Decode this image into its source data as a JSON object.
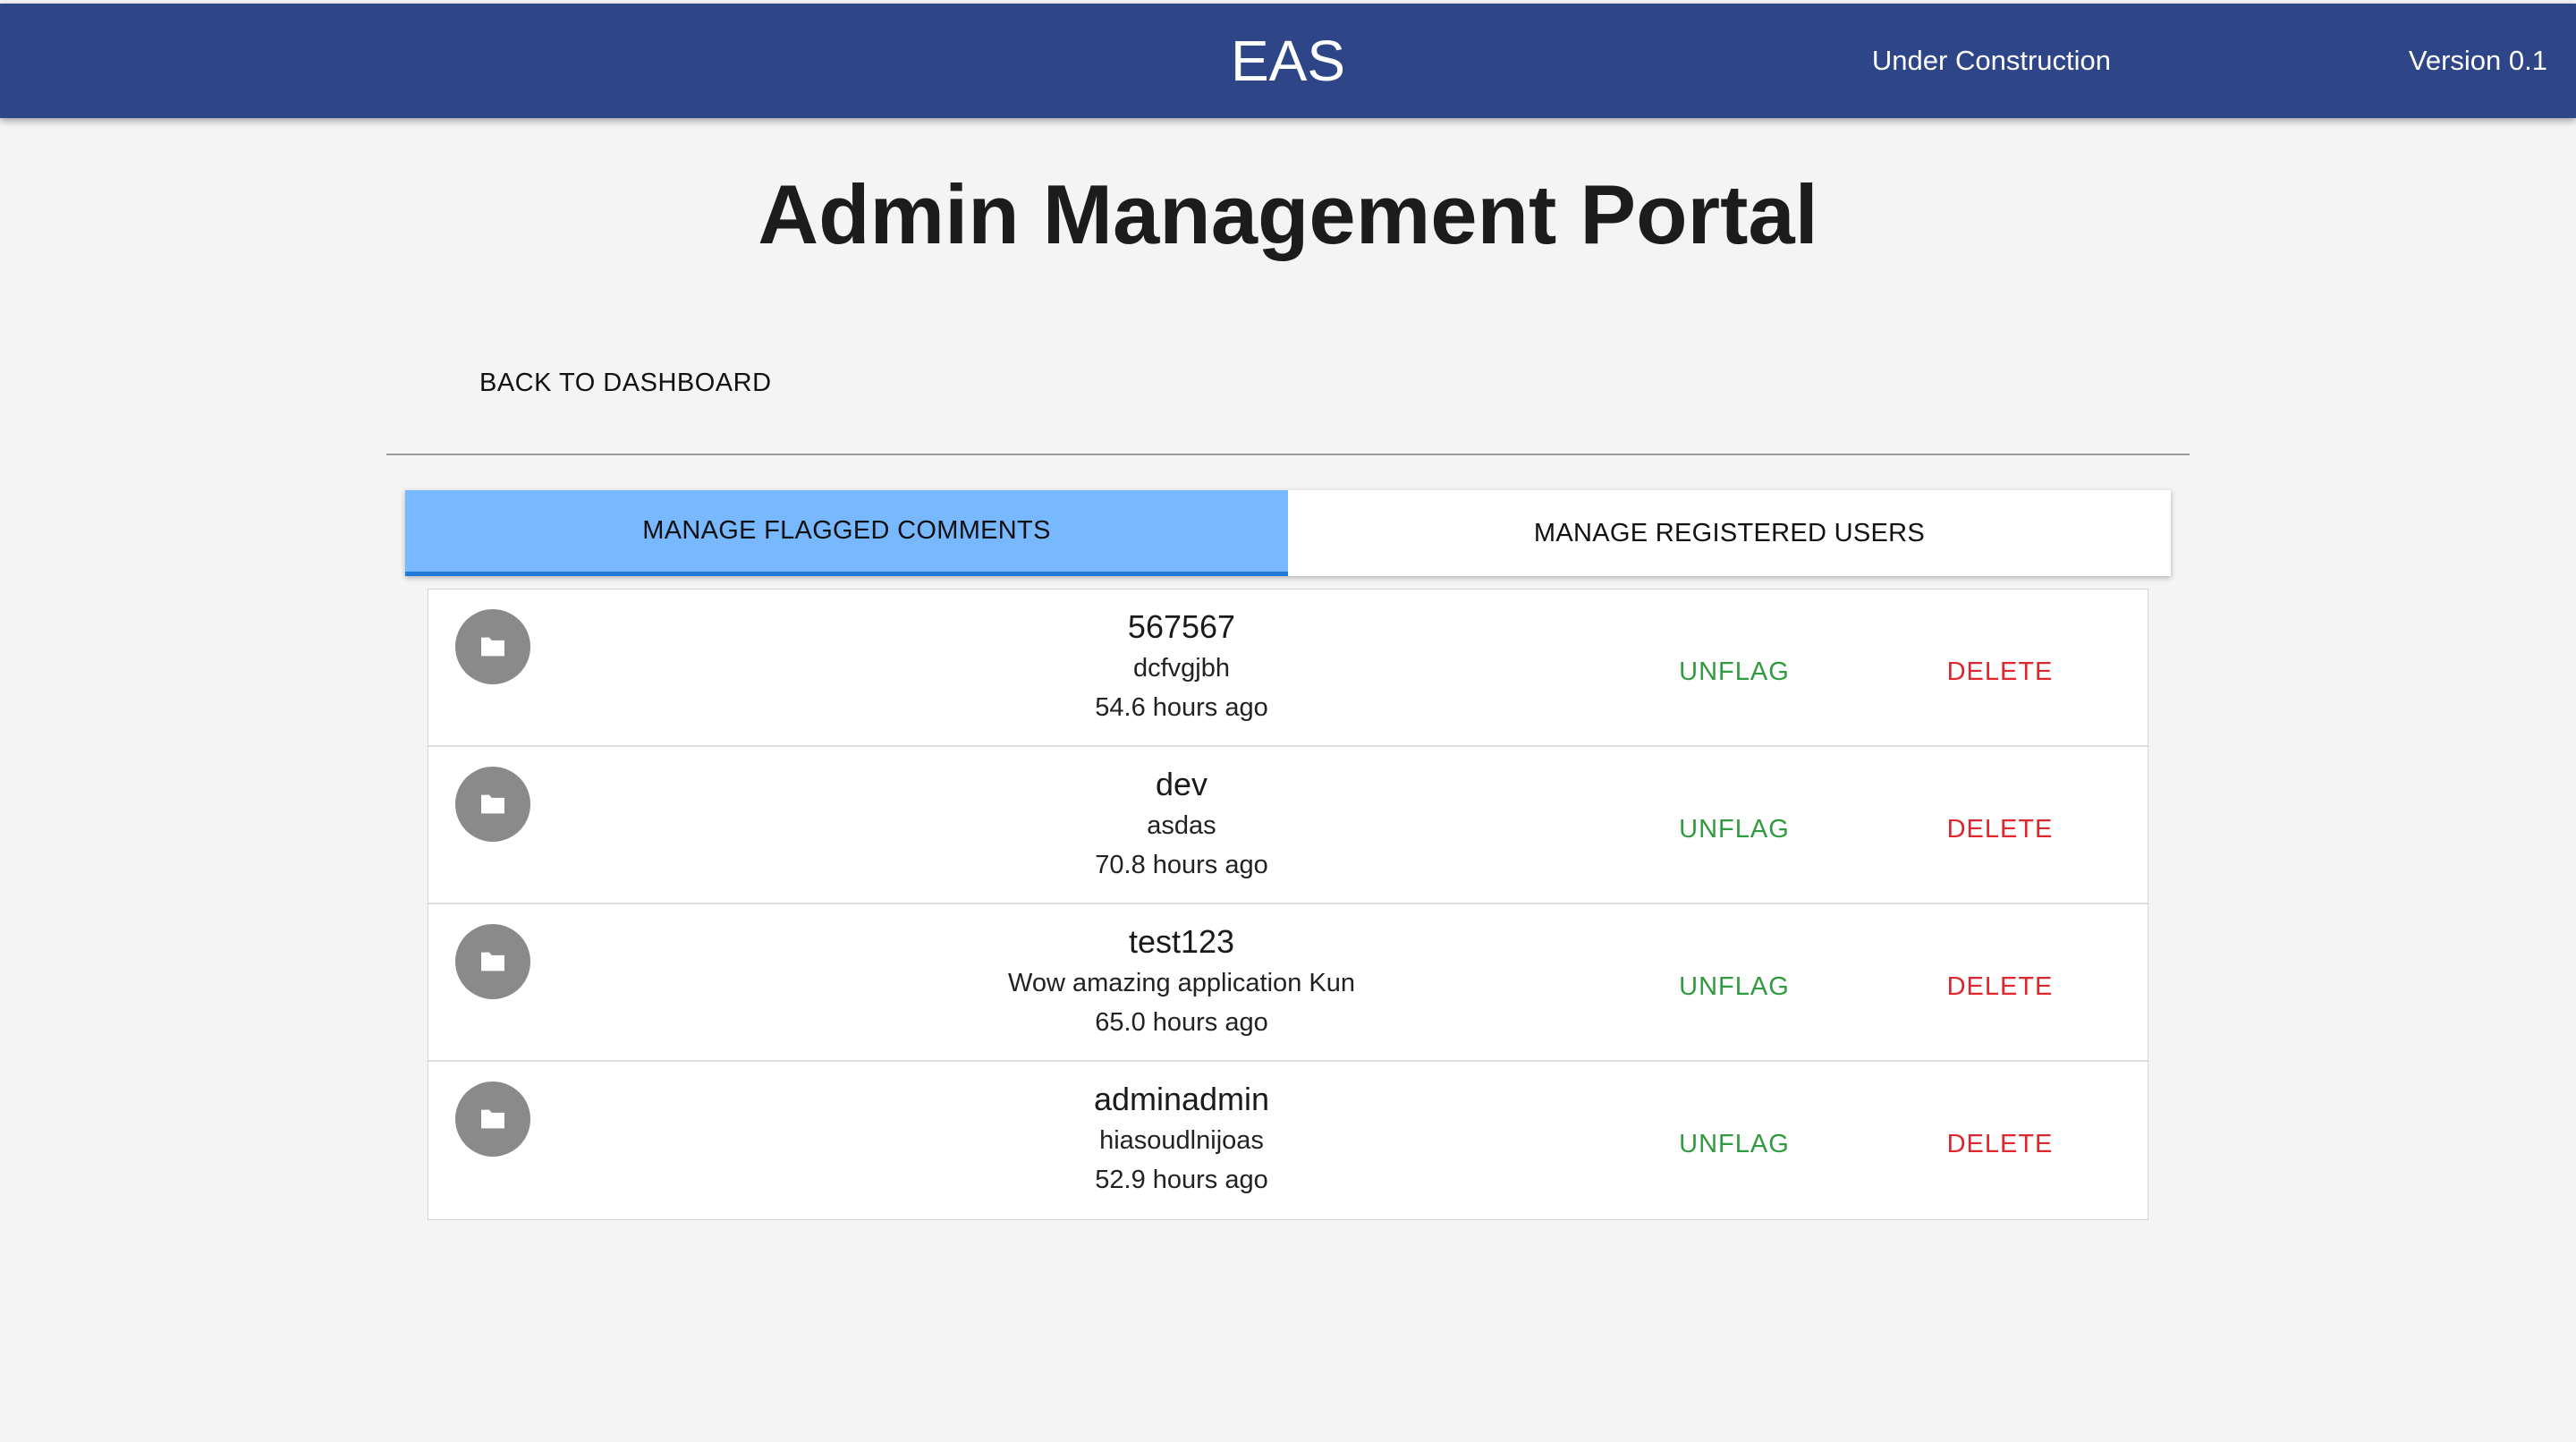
{
  "header": {
    "brand": "EAS",
    "under_construction": "Under Construction",
    "version": "Version 0.1"
  },
  "page": {
    "title": "Admin Management Portal",
    "back_label": "BACK TO DASHBOARD"
  },
  "tabs": [
    {
      "label": "MANAGE FLAGGED COMMENTS",
      "active": true
    },
    {
      "label": "MANAGE REGISTERED USERS",
      "active": false
    }
  ],
  "comments": [
    {
      "user": "567567",
      "text": "dcfvgjbh",
      "time": "54.6 hours ago",
      "icon": "folder-icon"
    },
    {
      "user": "dev",
      "text": "asdas",
      "time": "70.8 hours ago",
      "icon": "folder-icon"
    },
    {
      "user": "test123",
      "text": "Wow amazing application Kun",
      "time": "65.0 hours ago",
      "icon": "folder-icon"
    },
    {
      "user": "adminadmin",
      "text": "hiasoudlnijoas",
      "time": "52.9 hours ago",
      "icon": "folder-icon"
    }
  ],
  "actions": {
    "unflag_label": "UNFLAG",
    "delete_label": "DELETE"
  },
  "colors": {
    "appbar": "#2e4587",
    "active_tab": "#78b8ff",
    "unflag": "#2e9b3e",
    "delete": "#e0262d"
  }
}
